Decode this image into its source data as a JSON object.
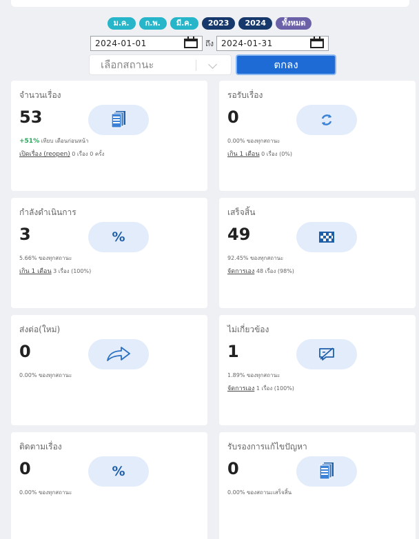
{
  "chips": [
    {
      "label": "ม.ค.",
      "color": "#26b5c9"
    },
    {
      "label": "ก.พ.",
      "color": "#26b5c9"
    },
    {
      "label": "มี.ค.",
      "color": "#26b5c9"
    },
    {
      "label": "2023",
      "color": "#16386a"
    },
    {
      "label": "2024",
      "color": "#16386a"
    },
    {
      "label": "ทั้งหมด",
      "color": "#6a61a8"
    }
  ],
  "filter": {
    "date_from": "2024-01-01",
    "to_label": "ถึง",
    "date_to": "2024-01-31",
    "status_placeholder": "เลือกสถานะ",
    "ok_label": "ตกลง"
  },
  "cards": [
    {
      "title": "จำนวนเรื่อง",
      "value": "53",
      "icon": "documents-icon",
      "line1_highlight": "+51%",
      "line1_text": " เทียบ เดือนก่อนหน้า",
      "line2_link": "เปิดเรื่อง (reopen)",
      "line2_text": " 0 เรื่อง 0 ครั้ง"
    },
    {
      "title": "รอรับเรื่อง",
      "value": "0",
      "icon": "refresh-icon",
      "line1_highlight": "",
      "line1_text": "0.00% ของทุกสถานะ",
      "line2_link": "เกิน 1 เดือน",
      "line2_text": " 0 เรื่อง (0%)"
    },
    {
      "title": "กำลังดำเนินการ",
      "value": "3",
      "icon": "percent-icon",
      "line1_highlight": "",
      "line1_text": "5.66% ของทุกสถานะ",
      "line2_link": "เกิน 1 เดือน",
      "line2_text": " 3 เรื่อง (100%)"
    },
    {
      "title": "เสร็จสิ้น",
      "value": "49",
      "icon": "checkered-flag-icon",
      "line1_highlight": "",
      "line1_text": "92.45% ของทุกสถานะ",
      "line2_link": "จัดการเอง",
      "line2_text": " 48 เรื่อง (98%)"
    },
    {
      "title": "ส่งต่อ(ใหม่)",
      "value": "0",
      "icon": "share-arrow-icon",
      "line1_highlight": "",
      "line1_text": "0.00% ของทุกสถานะ",
      "line2_link": "",
      "line2_text": ""
    },
    {
      "title": "ไม่เกี่ยวข้อง",
      "value": "1",
      "icon": "comment-slash-icon",
      "line1_highlight": "",
      "line1_text": "1.89% ของทุกสถานะ",
      "line2_link": "จัดการเอง",
      "line2_text": " 1 เรื่อง (100%)"
    },
    {
      "title": "ติดตามเรื่อง",
      "value": "0",
      "icon": "percent-icon",
      "line1_highlight": "",
      "line1_text": "0.00% ของทุกสถานะ",
      "line2_link": "",
      "line2_text": ""
    },
    {
      "title": "รับรองการแก้ไขปัญหา",
      "value": "0",
      "icon": "documents-icon",
      "line1_highlight": "",
      "line1_text": "0.00% ของสถานะเสร็จสิ้น",
      "line2_link": "",
      "line2_text": ""
    }
  ]
}
